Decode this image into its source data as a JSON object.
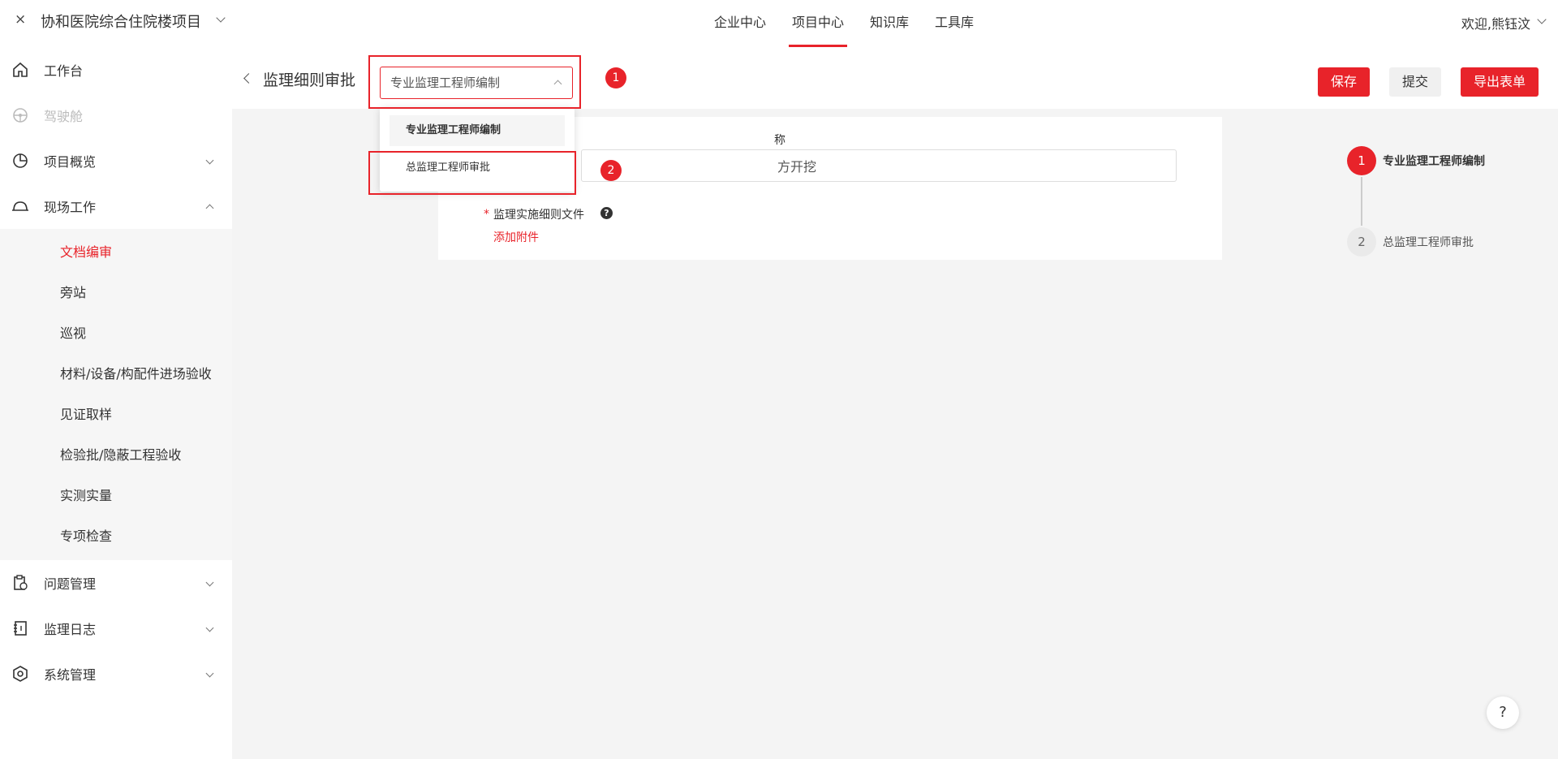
{
  "topbar": {
    "close_glyph": "×",
    "project_name": "协和医院综合住院楼项目",
    "nav": [
      "企业中心",
      "项目中心",
      "知识库",
      "工具库"
    ],
    "active_nav": "项目中心",
    "welcome": "欢迎,熊钰汶"
  },
  "sidebar": {
    "items": [
      {
        "label": "工作台",
        "icon": "home-icon"
      },
      {
        "label": "驾驶舱",
        "icon": "steering-wheel-icon",
        "disabled": true
      },
      {
        "label": "项目概览",
        "icon": "pie-chart-icon"
      },
      {
        "label": "现场工作",
        "icon": "hard-hat-icon",
        "expanded": true
      }
    ],
    "sub_items": [
      "文档编审",
      "旁站",
      "巡视",
      "材料/设备/构配件进场验收",
      "见证取样",
      "检验批/隐蔽工程验收",
      "实测实量",
      "专项检查"
    ],
    "active_sub": "文档编审",
    "bottom_items": [
      {
        "label": "问题管理",
        "icon": "clipboard-icon"
      },
      {
        "label": "监理日志",
        "icon": "notebook-icon"
      },
      {
        "label": "系统管理",
        "icon": "settings-hex-icon"
      }
    ]
  },
  "main": {
    "title": "监理细则审批",
    "select_value": "专业监理工程师编制",
    "dropdown_options": [
      "专业监理工程师编制",
      "总监理工程师审批"
    ],
    "buttons": {
      "save": "保存",
      "submit": "提交",
      "export": "导出表单"
    },
    "annotations": [
      "1",
      "2"
    ],
    "form": {
      "field1_label_tail": "称",
      "field1_value_tail": "方开挖",
      "required_star": "*",
      "file_label": "监理实施细则文件",
      "help": "?",
      "add_attachment": "添加附件"
    },
    "steps": [
      {
        "num": "1",
        "label": "专业监理工程师编制"
      },
      {
        "num": "2",
        "label": "总监理工程师审批"
      }
    ],
    "help_float": "?"
  },
  "colors": {
    "accent": "#e8232a",
    "bg": "#f4f4f4"
  }
}
